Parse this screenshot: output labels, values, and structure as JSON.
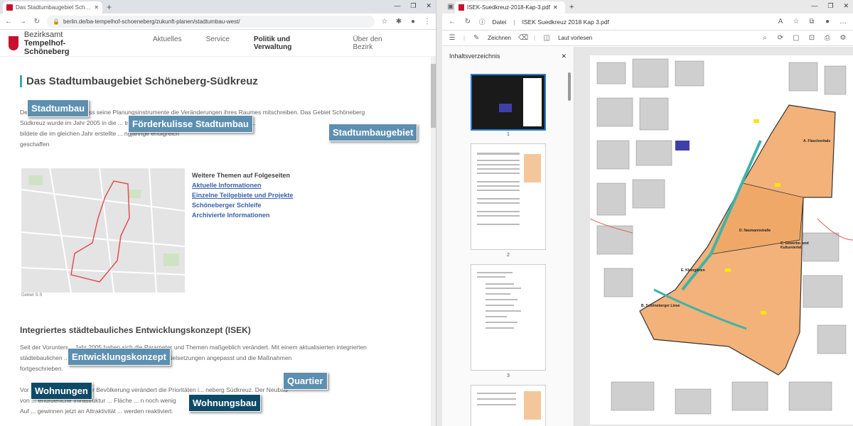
{
  "left_browser": {
    "tab_title": "Das Stadtumbaugebiet Schöneb...",
    "url": "berlin.de/ba-tempelhof-schoeneberg/zukunft-planen/stadtumbau-west/",
    "new_tab": "+",
    "window_controls": [
      "—",
      "❐",
      "✕"
    ]
  },
  "site": {
    "brand_line1": "Bezirksamt",
    "brand_line2": "Tempelhof-Schöneberg",
    "nav": [
      "Aktuelles",
      "Service",
      "Politik und Verwaltung",
      "Über den Bezirk"
    ],
    "page_title": "Das Stadtumbaugebiet Schöneberg-Südkreuz",
    "intro_lines": [
      "Der Stadtumbau ...ion, dass seine Planungsinstrumente die Veränderungen ihres Raumes mitschreiben. Das Gebiet Schöneberg",
      "Südkreuz wurde im Jahr 2005 in die ... trales Planungselement und Leitplan mit neuen...",
      "bildete die im gleichen Jahr erstellte ... ngjährige erfolgreich",
      "geschaffen"
    ],
    "map_caption": "Gebiet S-S",
    "themes_heading": "Weitere Themen auf Folgeseiten",
    "theme_links": [
      "Aktuelle Informationen",
      "Einzelne Teilgebiete und Projekte",
      "Schöneberger Schleife",
      "Archivierte Informationen"
    ],
    "isek_heading": "Integriertes städtebauliches Entwicklungskonzept (ISEK)",
    "isek_lines": [
      "Seit der Vorunters... Jahr 2005 haben sich die Parameter und Themen maßgeblich verändert. Mit einem aktualisierten integrierten",
      "städtebaulichen ... veränderte Situation dargestellt, die Zielsetzungen angepasst und die Maßnahmen",
      "fortgeschrieben.",
      "",
      "Vor ... allende Zunahme der Bevölkerung verändert die Prioritäten i... neberg Südkreuz. Der Neubau",
      "von ... erforderliche Infrastruktur ... Fläche ... n noch wenig",
      "Auf ... gewinnen jetzt an Attraktivität ... werden reaktiviert."
    ]
  },
  "tags": [
    "Stadtumbau",
    "Förderkulisse Stadtumbau",
    "Stadtumbaugebiet",
    "Entwicklungskonzept",
    "Wohnungen",
    "Quartier",
    "Wohnungsbau"
  ],
  "edge": {
    "tab_title": "ISEK-Suedkreuz-2018-Kap-3.pdf",
    "file_label": "Datei",
    "doc_title": "ISEK Suedkreuz 2018 Kap 3.pdf",
    "draw_label": "Zeichnen",
    "read_aloud": "Laut vorlesen",
    "toc_title": "Inhaltsverzeichnis",
    "page_numbers": [
      "1",
      "2",
      "3"
    ],
    "map_labels": [
      "A. Flaschenhals",
      "B. Schöneberger Linse",
      "C. Gewerbe- und Kulturviertel",
      "D. Naumannstraße",
      "E. Kleingärten"
    ]
  },
  "colors": {
    "accent": "#3aa6b9",
    "tag": "#5c8fb0",
    "tag_dark": "#0e4a68",
    "area": "#f3b27a",
    "link": "#3b63a8"
  }
}
